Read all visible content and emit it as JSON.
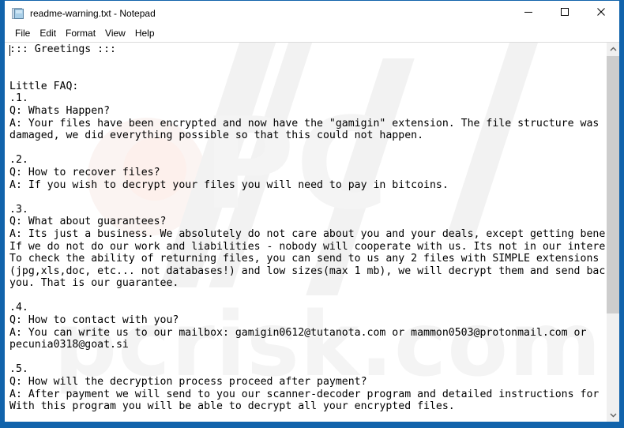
{
  "window": {
    "title": "readme-warning.txt - Notepad",
    "icon": "notepad-document-icon",
    "border_color": "#1163ab",
    "controls": {
      "minimize_label": "─",
      "maximize_label": "□",
      "close_label": "✕"
    }
  },
  "menubar": {
    "items": [
      {
        "label": "File"
      },
      {
        "label": "Edit"
      },
      {
        "label": "Format"
      },
      {
        "label": "View"
      },
      {
        "label": "Help"
      }
    ]
  },
  "editor": {
    "text": "::: Greetings :::\n\n\nLittle FAQ:\n.1.\nQ: Whats Happen?\nA: Your files have been encrypted and now have the \"gamigin\" extension. The file structure was not\ndamaged, we did everything possible so that this could not happen.\n\n.2.\nQ: How to recover files?\nA: If you wish to decrypt your files you will need to pay in bitcoins.\n\n.3.\nQ: What about guarantees?\nA: Its just a business. We absolutely do not care about you and your deals, except getting benefits.\nIf we do not do our work and liabilities - nobody will cooperate with us. Its not in our interests.\nTo check the ability of returning files, you can send to us any 2 files with SIMPLE extensions\n(jpg,xls,doc, etc... not databases!) and low sizes(max 1 mb), we will decrypt them and send back to\nyou. That is our guarantee.\n\n.4.\nQ: How to contact with you?\nA: You can write us to our mailbox: gamigin0612@tutanota.com or mammon0503@protonmail.com or\npecunia0318@goat.si\n\n.5.\nQ: How will the decryption process proceed after payment?\nA: After payment we will send to you our scanner-decoder program and detailed instructions for use.\nWith this program you will be able to decrypt all your encrypted files."
  },
  "scrollbar": {
    "up_arrow_glyph": "˄",
    "down_arrow_glyph": "˅",
    "thumb_top_percent": 0,
    "thumb_height_percent": 73,
    "track_color": "#f0f0f0",
    "thumb_color": "#cdcdcd"
  },
  "watermark": {
    "text_1": "pcrisk.com",
    "text_2": "PC"
  }
}
